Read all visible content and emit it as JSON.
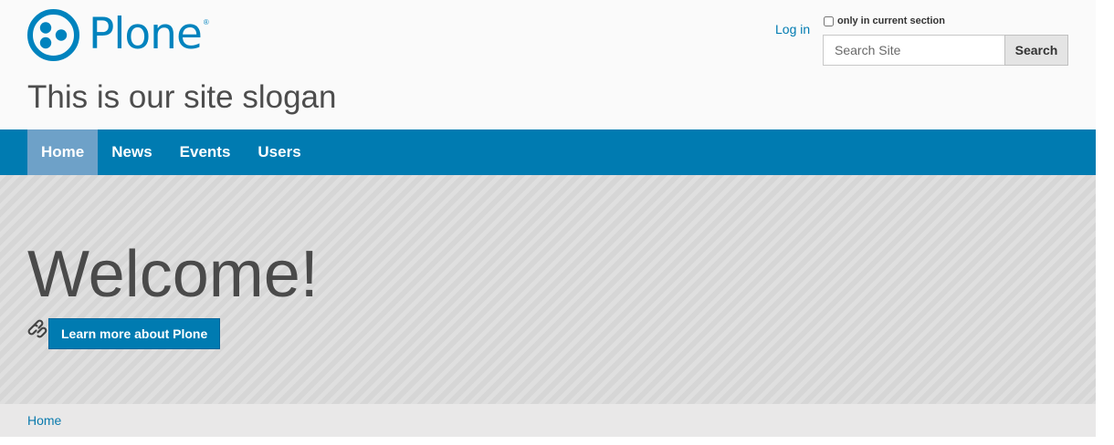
{
  "header": {
    "logo_text": "Plone",
    "logo_mark": "®",
    "slogan": "This is our site slogan"
  },
  "personal_tools": {
    "login_label": "Log in"
  },
  "search": {
    "section_only_label": "only in current section",
    "section_only_checked": false,
    "placeholder": "Search Site",
    "value": "",
    "button_label": "Search"
  },
  "navigation": {
    "items": [
      {
        "label": "Home",
        "selected": true
      },
      {
        "label": "News",
        "selected": false
      },
      {
        "label": "Events",
        "selected": false
      },
      {
        "label": "Users",
        "selected": false
      }
    ]
  },
  "hero": {
    "title": "Welcome!",
    "link_icon": "link-icon",
    "button_label": "Learn more about Plone"
  },
  "breadcrumbs": {
    "items": [
      "Home"
    ]
  },
  "colors": {
    "brand_blue": "#007bb1",
    "nav_selected": "#6ea1c8",
    "header_bg": "#fafafa",
    "hero_bg": "#d6d6d6",
    "breadcrumb_bg": "#e9e8e8"
  }
}
